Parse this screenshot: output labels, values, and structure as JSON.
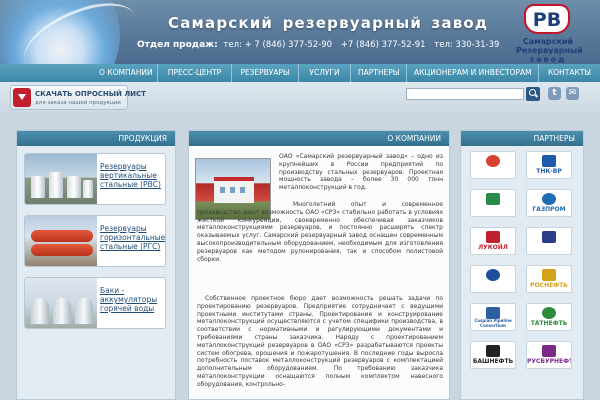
{
  "header": {
    "site_title": "Самарский резервуарный завод",
    "sales_label": "Отдел продаж:",
    "phones": [
      "тел: + 7 (846) 377-52-90",
      "+7 (846) 377-52-91",
      "тел: 330-31-39"
    ],
    "logo": {
      "emblem_letters": "РВ",
      "lines": [
        "Самарский",
        "Резервуарный",
        "завод"
      ]
    }
  },
  "nav": {
    "items": [
      "О КОМПАНИИ",
      "ПРЕСС-ЦЕНТР",
      "РЕЗЕРВУАРЫ",
      "УСЛУГИ",
      "ПАРТНЕРЫ",
      "АКЦИОНЕРАМ И ИНВЕСТОРАМ",
      "КОНТАКТЫ"
    ]
  },
  "download": {
    "title": "СКАЧАТЬ ОПРОСНЫЙ ЛИСТ",
    "subtitle": "для заказа нашей продукции"
  },
  "search": {
    "placeholder": ""
  },
  "social": {
    "twitter_glyph": "t",
    "mail_glyph": "✉"
  },
  "products": {
    "heading": "ПРОДУКЦИЯ",
    "items": [
      {
        "label": "Резервуары вертикальные стальные (РВС)"
      },
      {
        "label": "Резервуары горизонтальные стальные (РГС)"
      },
      {
        "label": "Баки - аккумуляторы горячей воды"
      }
    ]
  },
  "about": {
    "heading": "О КОМПАНИИ",
    "intro": "ОАО «Самарский резервуарный завод» – одно из крупнейших в России предприятий по производству стальных резервуаров. Проектная мощность завода – более 30 000 тонн металлоконструкций в год.",
    "p1": "Многолетний опыт и современное производство дают возможность ОАО «СРЗ» стабильно работать в условиях жесткой конкуренции, своевременно обеспечивая заказчиков металлоконструкциями резервуаров, и постоянно расширять спектр оказываемых услуг. Самарский резервуарный завод оснащен современным высокопроизводительным оборудованием, необходимым для изготовления резервуаров как методом рулонирования, так и способом полистовой сборки.",
    "p2": "Собственное проектное бюро дает возможность решать задачи по проектированию резервуаров. Предприятие сотрудничает с ведущими проектными институтами страны. Проектирование и конструирование металлоконструкций осуществляются с учетом специфики производства, в соответствии с нормативными и регулирующими документами и требованиями страны заказчика. Наряду с проектированием металлоконструкций резервуаров в ОАО «СРЗ» разрабатываются проекты систем обогрева, орошения и пожаротушения. В последние годы выросла потребность поставок металлоконструкций резервуаров с комплектацией дополнительным оборудованием. По требованию заказчика металлоконструкции оснащаются полным комплектом навесного оборудования, контрольно-"
  },
  "partners": {
    "heading": "ПАРТНЕРЫ",
    "items": [
      {
        "name": "",
        "color": "#d8412f"
      },
      {
        "name": "ТНК-ВР",
        "color": "#1f5ba8"
      },
      {
        "name": "",
        "color": "#2a8a4a"
      },
      {
        "name": "ГАЗПРОМ",
        "color": "#1f6db2"
      },
      {
        "name": "ЛУКОЙЛ",
        "color": "#c21f2e"
      },
      {
        "name": "",
        "color": "#2c3e8a"
      },
      {
        "name": "",
        "color": "#1f4f99"
      },
      {
        "name": "РОСНЕФТЬ",
        "color": "#d4a21a"
      },
      {
        "name": "Caspian Pipeline Consortium",
        "color": "#2a5ea0"
      },
      {
        "name": "ТАТНЕФТЬ",
        "color": "#2d8a3c"
      },
      {
        "name": "БАШНЕФТЬ",
        "color": "#222222"
      },
      {
        "name": "РУСБУРНЕФТЬ",
        "color": "#7b2a8a"
      }
    ]
  }
}
